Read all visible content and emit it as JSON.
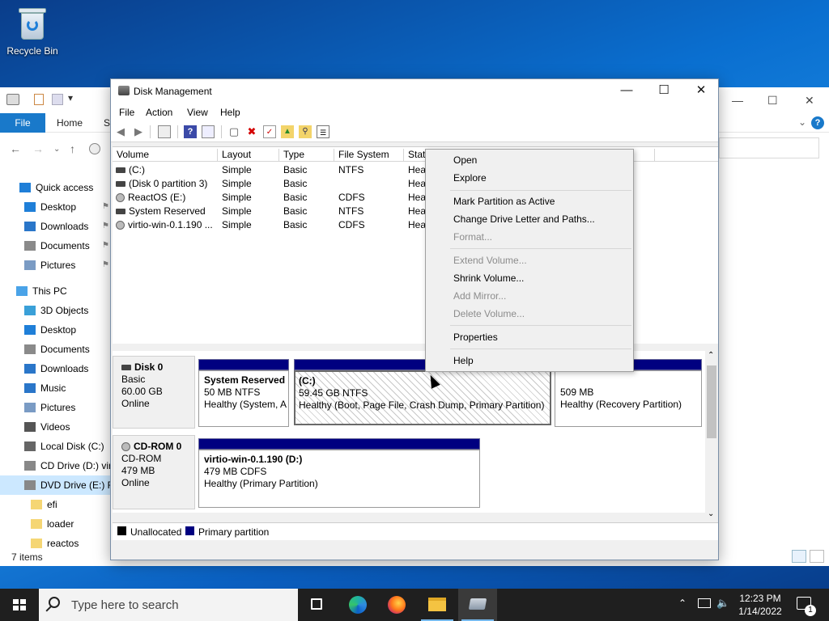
{
  "desktop": {
    "recycle_bin_label": "Recycle Bin"
  },
  "explorer": {
    "ribbon": {
      "file": "File",
      "home": "Home",
      "share_partial": "S",
      "help": "?"
    },
    "nav_items": [
      {
        "label": "Quick access",
        "icon": "star-icon",
        "color": "#1f7fd8"
      },
      {
        "label": "Desktop",
        "icon": "desktop-folder-icon",
        "color": "#1f7fd8",
        "pinned": true
      },
      {
        "label": "Downloads",
        "icon": "downloads-icon",
        "color": "#2a76c9",
        "pinned": true
      },
      {
        "label": "Documents",
        "icon": "documents-icon",
        "color": "#8a8a8a",
        "pinned": true
      },
      {
        "label": "Pictures",
        "icon": "pictures-icon",
        "color": "#7a9bc4",
        "pinned": true
      },
      {
        "label": "This PC",
        "icon": "pc-icon",
        "color": "#4aa3e8"
      },
      {
        "label": "3D Objects",
        "icon": "3d-objects-icon",
        "color": "#3aa0d8"
      },
      {
        "label": "Desktop",
        "icon": "desktop-folder-icon",
        "color": "#1f7fd8"
      },
      {
        "label": "Documents",
        "icon": "documents-icon",
        "color": "#8a8a8a"
      },
      {
        "label": "Downloads",
        "icon": "downloads-icon",
        "color": "#2a76c9"
      },
      {
        "label": "Music",
        "icon": "music-icon",
        "color": "#2a76c9"
      },
      {
        "label": "Pictures",
        "icon": "pictures-icon",
        "color": "#7a9bc4"
      },
      {
        "label": "Videos",
        "icon": "videos-icon",
        "color": "#555"
      },
      {
        "label": "Local Disk (C:)",
        "icon": "local-disk-icon",
        "color": "#666"
      },
      {
        "label": "CD Drive (D:) vir",
        "icon": "cd-drive-icon",
        "color": "#888"
      },
      {
        "label": "DVD Drive (E:) R",
        "icon": "dvd-drive-icon",
        "color": "#888",
        "selected": true
      },
      {
        "label": "efi",
        "icon": "folder-icon",
        "color": "#f5d674"
      },
      {
        "label": "loader",
        "icon": "folder-icon",
        "color": "#f5d674"
      },
      {
        "label": "reactos",
        "icon": "folder-icon",
        "color": "#f5d674"
      }
    ],
    "status": "7 items"
  },
  "disk_mgmt": {
    "title": "Disk Management",
    "menu": [
      "File",
      "Action",
      "View",
      "Help"
    ],
    "columns": [
      "Volume",
      "Layout",
      "Type",
      "File System",
      "Statu"
    ],
    "volumes": [
      {
        "volume": "(C:)",
        "layout": "Simple",
        "type": "Basic",
        "fs": "NTFS",
        "status": "Hea",
        "icon": "drive"
      },
      {
        "volume": "(Disk 0 partition 3)",
        "layout": "Simple",
        "type": "Basic",
        "fs": "",
        "status": "Hea",
        "icon": "drive"
      },
      {
        "volume": "ReactOS (E:)",
        "layout": "Simple",
        "type": "Basic",
        "fs": "CDFS",
        "status": "Hea",
        "icon": "cd"
      },
      {
        "volume": "System Reserved",
        "layout": "Simple",
        "type": "Basic",
        "fs": "NTFS",
        "status": "Hea",
        "icon": "drive"
      },
      {
        "volume": "virtio-win-0.1.190 ...",
        "layout": "Simple",
        "type": "Basic",
        "fs": "CDFS",
        "status": "Hea",
        "icon": "cd"
      }
    ],
    "disks": [
      {
        "name": "Disk 0",
        "kind": "Basic",
        "size": "60.00 GB",
        "status": "Online",
        "partitions": [
          {
            "name": "System Reserved",
            "detail": "50 MB NTFS",
            "health": "Healthy (System, A"
          },
          {
            "name": "(C:)",
            "detail": "59.45 GB NTFS",
            "health": "Healthy (Boot, Page File, Crash Dump, Primary Partition)"
          },
          {
            "name": "",
            "detail": "509 MB",
            "health": "Healthy (Recovery Partition)"
          }
        ]
      },
      {
        "name": "CD-ROM 0",
        "kind": "CD-ROM",
        "size": "479 MB",
        "status": "Online",
        "partitions": [
          {
            "name": "virtio-win-0.1.190  (D:)",
            "detail": "479 MB CDFS",
            "health": "Healthy (Primary Partition)"
          }
        ]
      }
    ],
    "legend": [
      {
        "label": "Unallocated",
        "color": "#000000"
      },
      {
        "label": "Primary partition",
        "color": "#000080"
      }
    ]
  },
  "context_menu": {
    "items": [
      {
        "label": "Open",
        "enabled": true
      },
      {
        "label": "Explore",
        "enabled": true
      },
      {
        "label": "Mark Partition as Active",
        "enabled": true
      },
      {
        "label": "Change Drive Letter and Paths...",
        "enabled": true
      },
      {
        "label": "Format...",
        "enabled": false
      },
      {
        "label": "Extend Volume...",
        "enabled": false
      },
      {
        "label": "Shrink Volume...",
        "enabled": true
      },
      {
        "label": "Add Mirror...",
        "enabled": false
      },
      {
        "label": "Delete Volume...",
        "enabled": false
      },
      {
        "label": "Properties",
        "enabled": true
      },
      {
        "label": "Help",
        "enabled": true
      }
    ]
  },
  "taskbar": {
    "search_placeholder": "Type here to search",
    "time": "12:23 PM",
    "date": "1/14/2022",
    "notifications": "1"
  }
}
